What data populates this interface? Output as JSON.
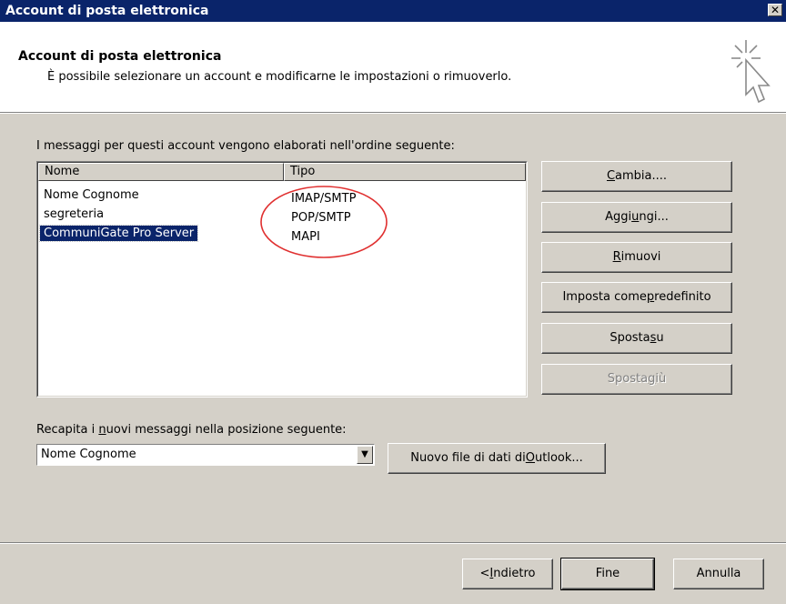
{
  "window": {
    "title": "Account di posta elettronica",
    "close_glyph": "✕"
  },
  "header": {
    "title": "Account di posta elettronica",
    "subtitle": "È possibile selezionare un account e modificarne le impostazioni o rimuoverlo.",
    "icon": "wizard-cursor-icon"
  },
  "accounts": {
    "intro_label": "I messaggi per questi account vengono elaborati nell'ordine seguente:",
    "columns": [
      "Nome",
      "Tipo"
    ],
    "rows": [
      {
        "name": "Nome Cognome",
        "type": "IMAP/SMTP",
        "selected": false
      },
      {
        "name": "segreteria",
        "type": "POP/SMTP",
        "selected": false
      },
      {
        "name": "CommuniGate Pro Server",
        "type": "MAPI",
        "selected": true
      }
    ],
    "annotation_color": "#e03030"
  },
  "side_buttons": {
    "change": {
      "pre": "",
      "u": "C",
      "post": "ambia...."
    },
    "add": {
      "pre": "Aggi",
      "u": "u",
      "post": "ngi..."
    },
    "remove": {
      "pre": "",
      "u": "R",
      "post": "imuovi"
    },
    "set_default": {
      "pre": "Imposta come ",
      "u": "p",
      "post": "redefinito"
    },
    "move_up": {
      "pre": "Sposta ",
      "u": "s",
      "post": "u"
    },
    "move_down": {
      "pre": "Sposta ",
      "u": "g",
      "post": "iù"
    }
  },
  "delivery": {
    "label": "Recapita i nuovi messaggi nella posizione seguente:",
    "label_pre": "Recapita i ",
    "label_u": "n",
    "label_post": "uovi messaggi nella posizione seguente:",
    "selected_value": "Nome Cognome",
    "new_file_button": {
      "pre": "Nuovo file di dati di ",
      "u": "O",
      "post": "utlook..."
    }
  },
  "footer": {
    "back": {
      "pre": "< ",
      "u": "I",
      "post": "ndietro"
    },
    "finish": "Fine",
    "cancel": "Annulla"
  },
  "colors": {
    "titlebar": "#0a246a",
    "dialog_bg": "#d4d0c8",
    "selection": "#0a246a"
  }
}
